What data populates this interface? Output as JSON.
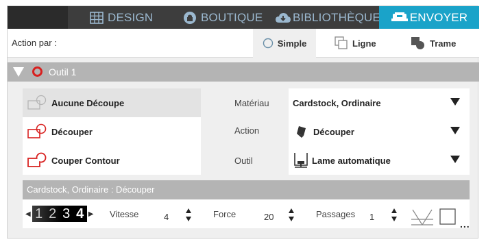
{
  "nav": {
    "tabs": [
      {
        "label": "DESIGN",
        "icon": "grid-icon"
      },
      {
        "label": "BOUTIQUE",
        "icon": "bag-icon"
      },
      {
        "label": "BIBLIOTHÈQUE",
        "icon": "cloud-icon"
      },
      {
        "label": "ENVOYER",
        "icon": "cutter-icon",
        "active": true
      }
    ],
    "accent": "#1aa3c9"
  },
  "action_bar": {
    "label": "Action par :",
    "modes": [
      {
        "label": "Simple",
        "selected": true
      },
      {
        "label": "Ligne"
      },
      {
        "label": "Trame"
      }
    ]
  },
  "tool": {
    "name": "Outil 1",
    "ring_color": "#d8201f"
  },
  "cut_options": [
    {
      "label": "Aucune Découpe",
      "selected": true
    },
    {
      "label": "Découper"
    },
    {
      "label": "Couper Contour"
    }
  ],
  "fields": {
    "material": {
      "label": "Matériau",
      "value": "Cardstock, Ordinaire"
    },
    "action": {
      "label": "Action",
      "value": "Découper"
    },
    "tool": {
      "label": "Outil",
      "value": "Lame automatique"
    }
  },
  "settings": {
    "summary": "Cardstock, Ordinaire : Découper",
    "presets": [
      "1",
      "2",
      "3",
      "4"
    ],
    "speed": {
      "label": "Vitesse",
      "value": "4"
    },
    "force": {
      "label": "Force",
      "value": "20"
    },
    "passes": {
      "label": "Passages",
      "value": "1"
    },
    "more": "..."
  }
}
